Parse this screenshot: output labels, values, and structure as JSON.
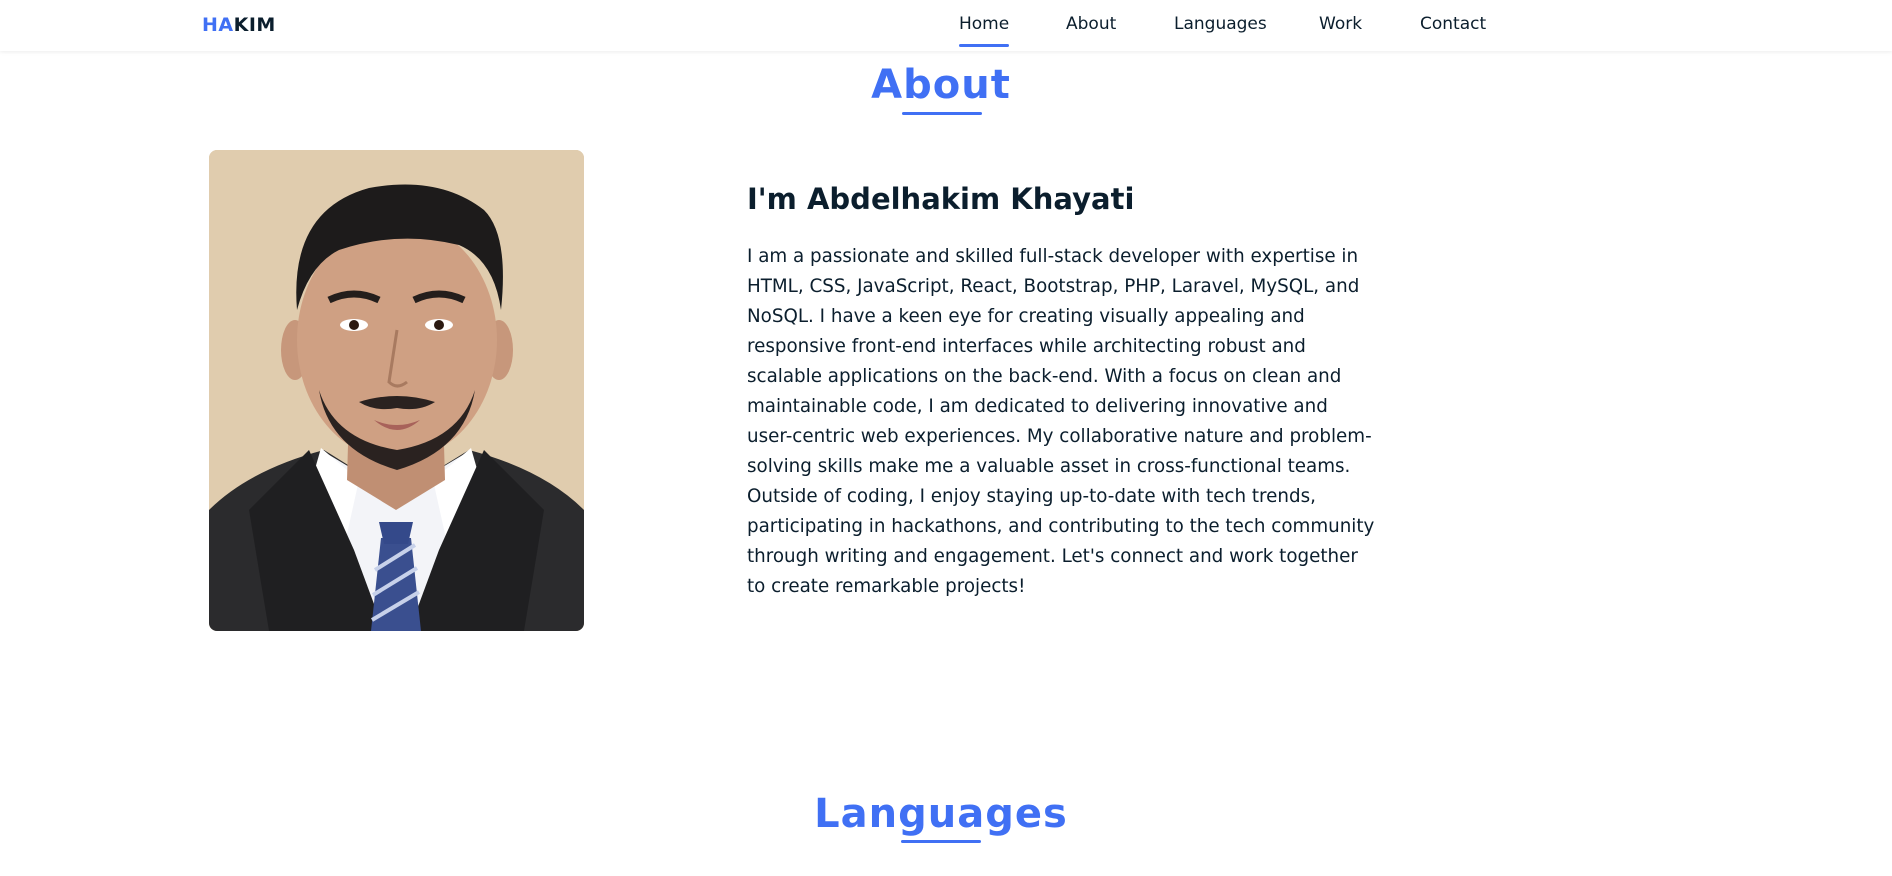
{
  "header": {
    "logo_highlight": "HA",
    "logo_rest": "KIM",
    "nav": [
      {
        "label": "Home",
        "active": true
      },
      {
        "label": "About",
        "active": false
      },
      {
        "label": "Languages",
        "active": false
      },
      {
        "label": "Work",
        "active": false
      },
      {
        "label": "Contact",
        "active": false
      }
    ]
  },
  "about": {
    "title": "About",
    "name": "I'm Abdelhakim Khayati",
    "bio": "I am a passionate and skilled full-stack developer with expertise in HTML, CSS, JavaScript, React, Bootstrap, PHP, Laravel, MySQL, and NoSQL. I have a keen eye for creating visually appealing and responsive front-end interfaces while architecting robust and scalable applications on the back-end. With a focus on clean and maintainable code, I am dedicated to delivering innovative and user-centric web experiences. My collaborative nature and problem-solving skills make me a valuable asset in cross-functional teams. Outside of coding, I enjoy staying up-to-date with tech trends, participating in hackathons, and contributing to the tech community through writing and engagement. Let's connect and work together to create remarkable projects!"
  },
  "languages": {
    "title": "Languages"
  },
  "colors": {
    "accent": "#4070f4",
    "text": "#0b1e2d",
    "photo_background": "#e0ccae"
  }
}
